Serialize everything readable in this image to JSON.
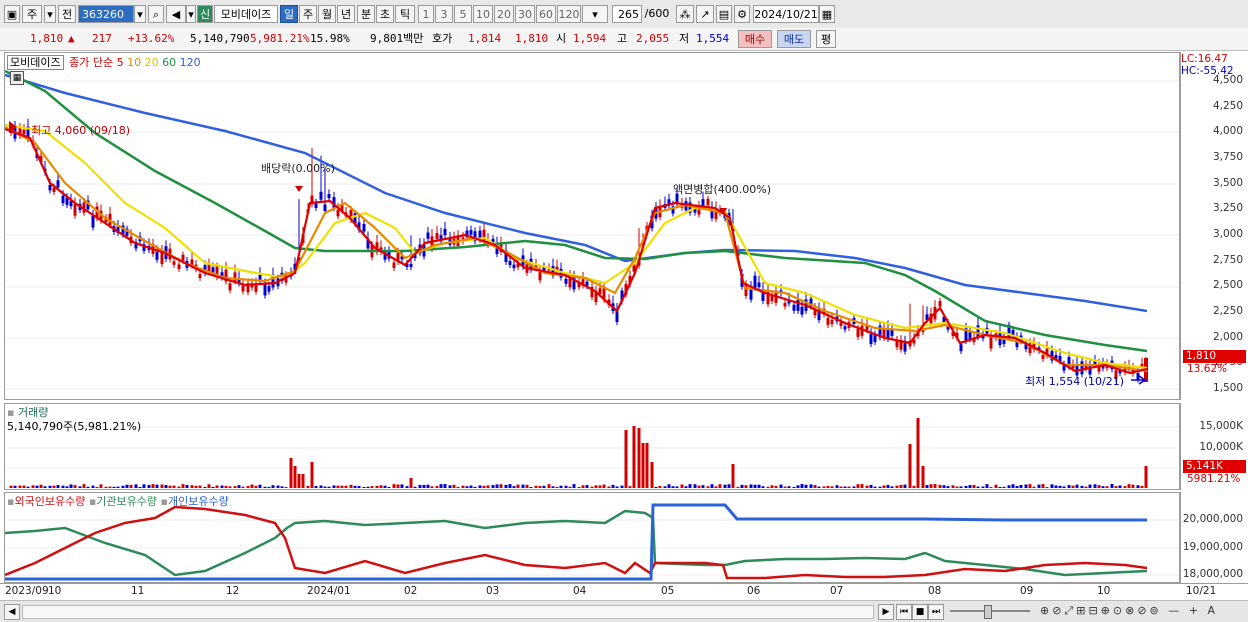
{
  "toolbar": {
    "period_left": "주",
    "prev_label": "전",
    "code": "363260",
    "new_badge": "신",
    "stock_name": "모비데이즈",
    "tabs": [
      "일",
      "주",
      "월",
      "년",
      "분",
      "초",
      "틱"
    ],
    "tab_selected": "일",
    "intervals": [
      "1",
      "3",
      "5",
      "10",
      "20",
      "30",
      "60",
      "120"
    ],
    "count": "265",
    "count_total": "/600",
    "date": "2024/10/21"
  },
  "quote": {
    "price": "1,810",
    "change": "217",
    "change_pct": "+13.62%",
    "volume": "5,140,790",
    "vol_pct": "5,981.21%",
    "turnover": "15.98%",
    "amount": "9,801백만",
    "bid_label": "호가",
    "bid": "1,814",
    "ask": "1,810",
    "open_label": "시",
    "open": "1,594",
    "high_label": "고",
    "high": "2,055",
    "low_label": "저",
    "low": "1,554",
    "buy_label": "매수",
    "sell_label": "매도",
    "avg_label": "평"
  },
  "price_panel": {
    "title": "모비데이즈",
    "legend_prefix": "종가 단순",
    "ma_periods": [
      "5",
      "10",
      "20",
      "60",
      "120"
    ],
    "ma_colors": [
      "#e00000",
      "#e88a00",
      "#f0e000",
      "#209040",
      "#3060e0"
    ],
    "lc": "LC:16.47",
    "hc": "HC:-55.42",
    "y_ticks": [
      "4,500",
      "4,250",
      "4,000",
      "3,750",
      "3,500",
      "3,250",
      "3,000",
      "2,750",
      "2,500",
      "2,250",
      "2,000",
      "1,750",
      "1,500"
    ],
    "high_note": "최고 4,060 (09/18)",
    "low_note": "최저 1,554 (10/21)",
    "dividend_note": "배당락(0.00%)",
    "split_note": "액면병합(400.00%)",
    "last_price_tag": "1,810",
    "last_change_tag": "13.62%"
  },
  "volume_panel": {
    "title": "거래량",
    "value_line": "5,140,790주(5,981.21%)",
    "y_ticks": [
      "15,000K",
      "10,000K",
      "5,000K"
    ],
    "last_tag": "5,141K",
    "last_pct": "5981.21%"
  },
  "holdings_panel": {
    "legend": [
      "외국인보유수량",
      "기관보유수량",
      "개인보유수량"
    ],
    "legend_colors": [
      "#d01010",
      "#2d8a5a",
      "#2a62d8"
    ],
    "y_ticks": [
      "20,000,000",
      "19,000,000",
      "18,000,000"
    ]
  },
  "x_axis": {
    "labels": [
      "2023/09",
      "10",
      "11",
      "12",
      "2024/01",
      "02",
      "03",
      "04",
      "05",
      "06",
      "07",
      "08",
      "09",
      "10",
      "10/21"
    ]
  },
  "colors": {
    "up": "#d00000",
    "down": "#0000d0",
    "accent": "#2d6cc0"
  }
}
